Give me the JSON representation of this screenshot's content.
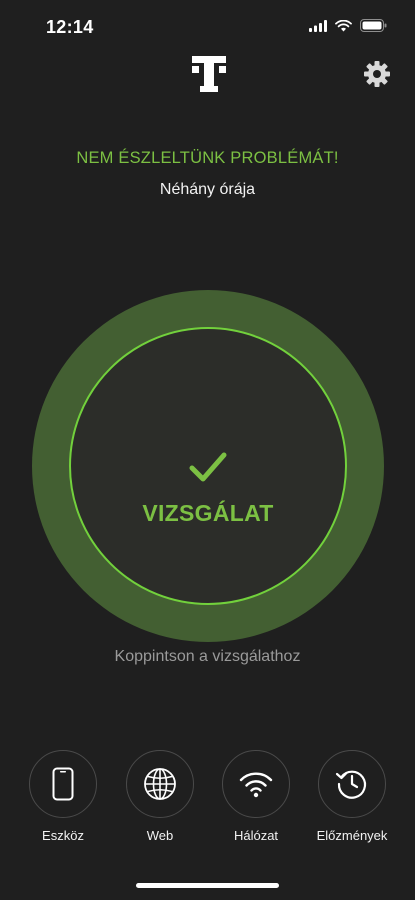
{
  "status_bar": {
    "time": "12:14"
  },
  "header": {
    "logo_icon": "t-logo-icon",
    "settings_icon": "gear-icon"
  },
  "status": {
    "headline": "NEM ÉSZLELTÜNK PROBLÉMÁT!",
    "subline": "Néhány órája"
  },
  "scan": {
    "label": "VIZSGÁLAT",
    "hint": "Koppintson a vizsgálathoz",
    "accent_color": "#7cc043"
  },
  "nav": {
    "items": [
      {
        "label": "Eszköz",
        "icon": "phone-icon"
      },
      {
        "label": "Web",
        "icon": "globe-icon"
      },
      {
        "label": "Hálózat",
        "icon": "wifi-icon"
      },
      {
        "label": "Előzmények",
        "icon": "history-icon"
      }
    ]
  }
}
